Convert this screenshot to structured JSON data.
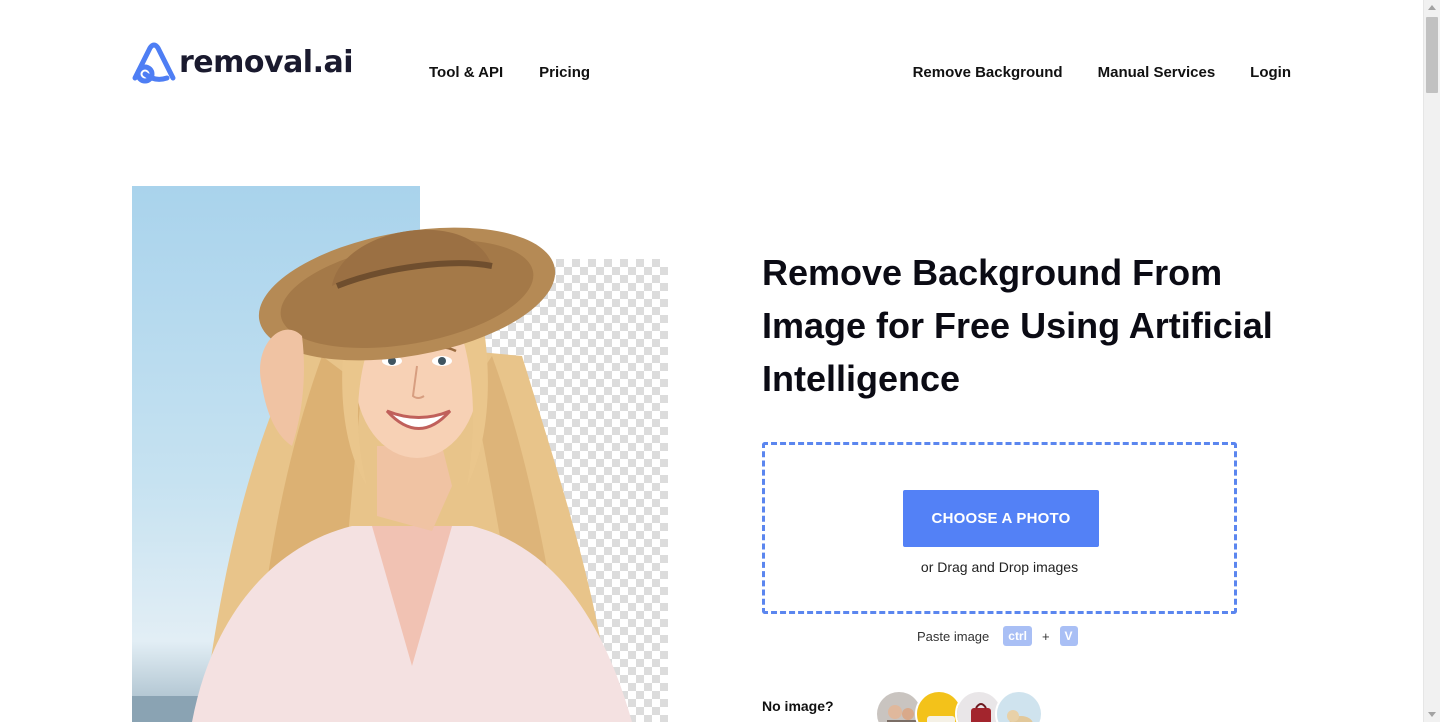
{
  "brand": {
    "name": "removal.ai",
    "accent": "#5381f6"
  },
  "nav": {
    "left": [
      {
        "label": "Tool & API"
      },
      {
        "label": "Pricing"
      }
    ],
    "right": [
      {
        "label": "Remove Background"
      },
      {
        "label": "Manual Services"
      },
      {
        "label": "Login"
      }
    ]
  },
  "hero": {
    "headline": "Remove Background From Image for Free Using Artificial Intelligence"
  },
  "upload": {
    "button_label": "CHOOSE A PHOTO",
    "drag_text": "or Drag and Drop images",
    "paste_label": "Paste image",
    "key_ctrl": "ctrl",
    "key_plus": "+",
    "key_v": "V"
  },
  "samples": {
    "label": "No image?",
    "icons": [
      "people-sample-icon",
      "car-sample-icon",
      "bag-sample-icon",
      "dog-sample-icon"
    ]
  }
}
